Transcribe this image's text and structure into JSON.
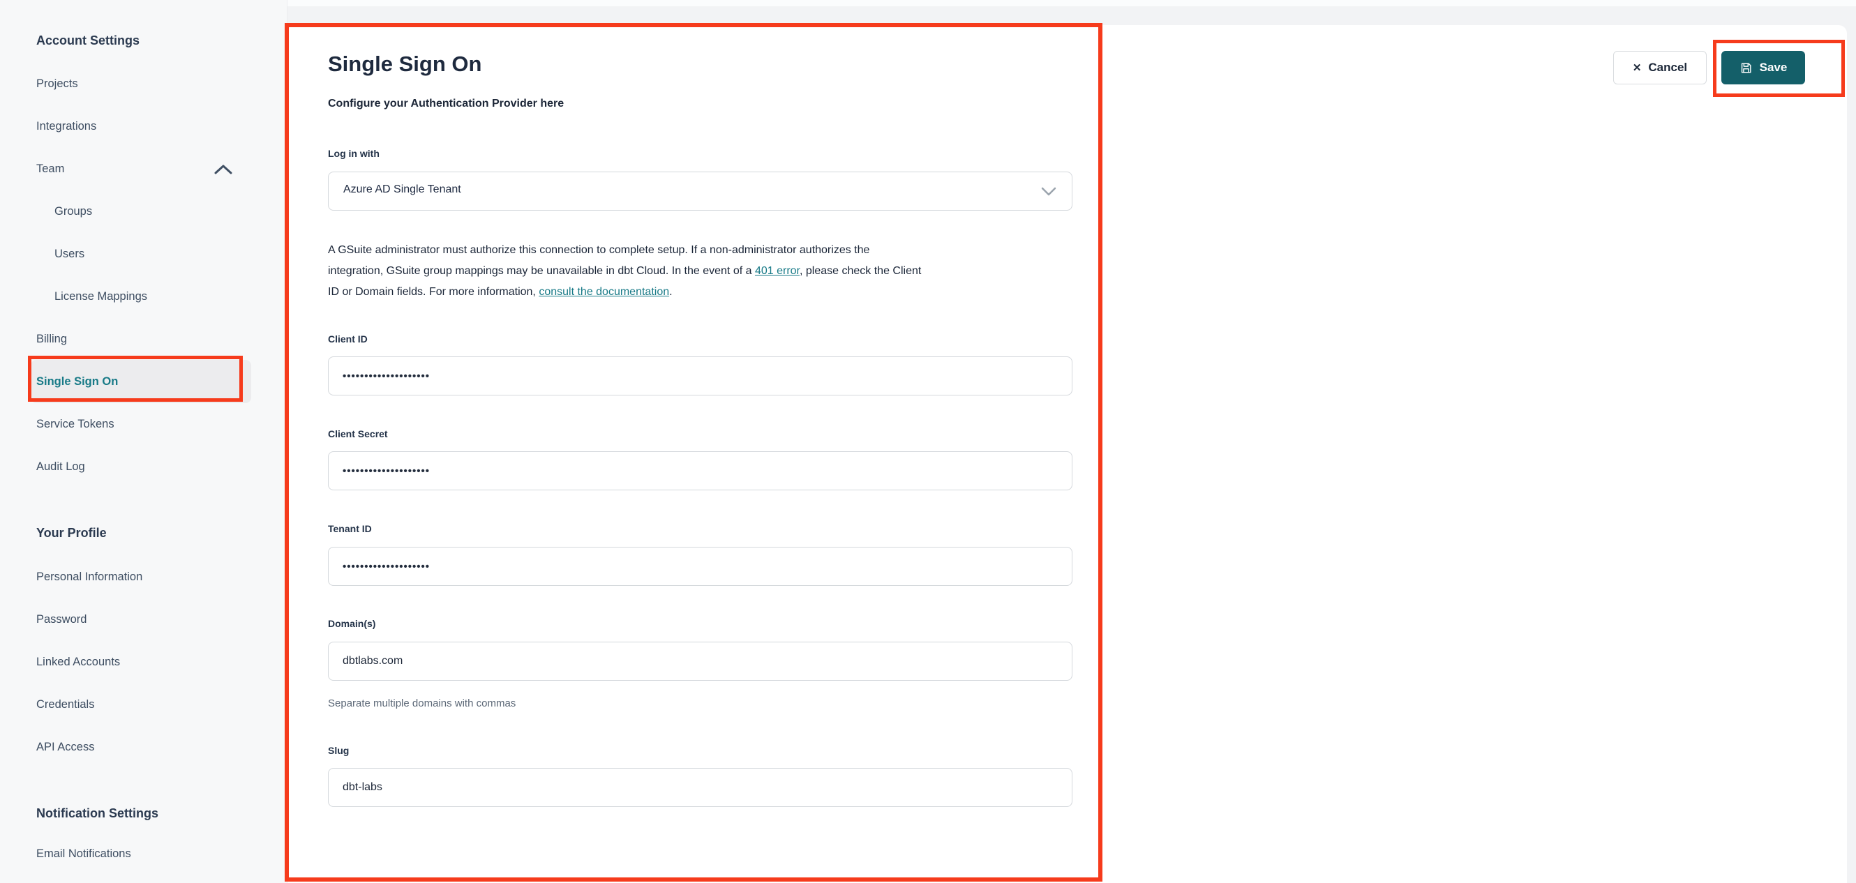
{
  "sidebar": {
    "sections": [
      {
        "title": "Account Settings",
        "items": [
          {
            "label": "Projects"
          },
          {
            "label": "Integrations"
          },
          {
            "label": "Team"
          },
          {
            "label": "Groups",
            "indent": true
          },
          {
            "label": "Users",
            "indent": true
          },
          {
            "label": "License Mappings",
            "indent": true
          },
          {
            "label": "Billing"
          },
          {
            "label": "Single Sign On",
            "active": true
          },
          {
            "label": "Service Tokens"
          },
          {
            "label": "Audit Log"
          }
        ]
      },
      {
        "title": "Your Profile",
        "items": [
          {
            "label": "Personal Information"
          },
          {
            "label": "Password"
          },
          {
            "label": "Linked Accounts"
          },
          {
            "label": "Credentials"
          },
          {
            "label": "API Access"
          }
        ]
      },
      {
        "title": "Notification Settings",
        "items": [
          {
            "label": "Email Notifications"
          }
        ]
      }
    ]
  },
  "header_actions": {
    "cancel_label": "Cancel",
    "cancel_icon": "x-icon",
    "save_label": "Save",
    "save_icon": "floppy-disk-icon"
  },
  "main": {
    "title": "Single Sign On",
    "subtitle": "Configure your Authentication Provider here",
    "login_with_label": "Log in with",
    "login_with_value": "Azure AD Single Tenant",
    "note": {
      "line1": "A GSuite administrator must authorize this connection to complete setup. If a non-administrator authorizes the",
      "line2_pre": "integration, GSuite group mappings may be unavailable in dbt Cloud. In the event of a ",
      "link_401": "401 error",
      "line2_post": ", please check the Client",
      "line3_pre": "ID or Domain fields. For more information, ",
      "link_docs": "consult the documentation",
      "line3_post": "."
    },
    "fields": {
      "client_id": {
        "label": "Client ID",
        "value": "••••••••••••••••••••"
      },
      "client_secret": {
        "label": "Client Secret",
        "value": "••••••••••••••••••••"
      },
      "tenant_id": {
        "label": "Tenant ID",
        "value": "••••••••••••••••••••"
      },
      "domains": {
        "label": "Domain(s)",
        "value": "dbtlabs.com",
        "help": "Separate multiple domains with commas"
      },
      "slug": {
        "label": "Slug",
        "value": "dbt-labs"
      }
    }
  },
  "colors": {
    "annotation_red": "#f63b1c",
    "save_teal": "#145f69",
    "link_teal": "#187a87"
  }
}
